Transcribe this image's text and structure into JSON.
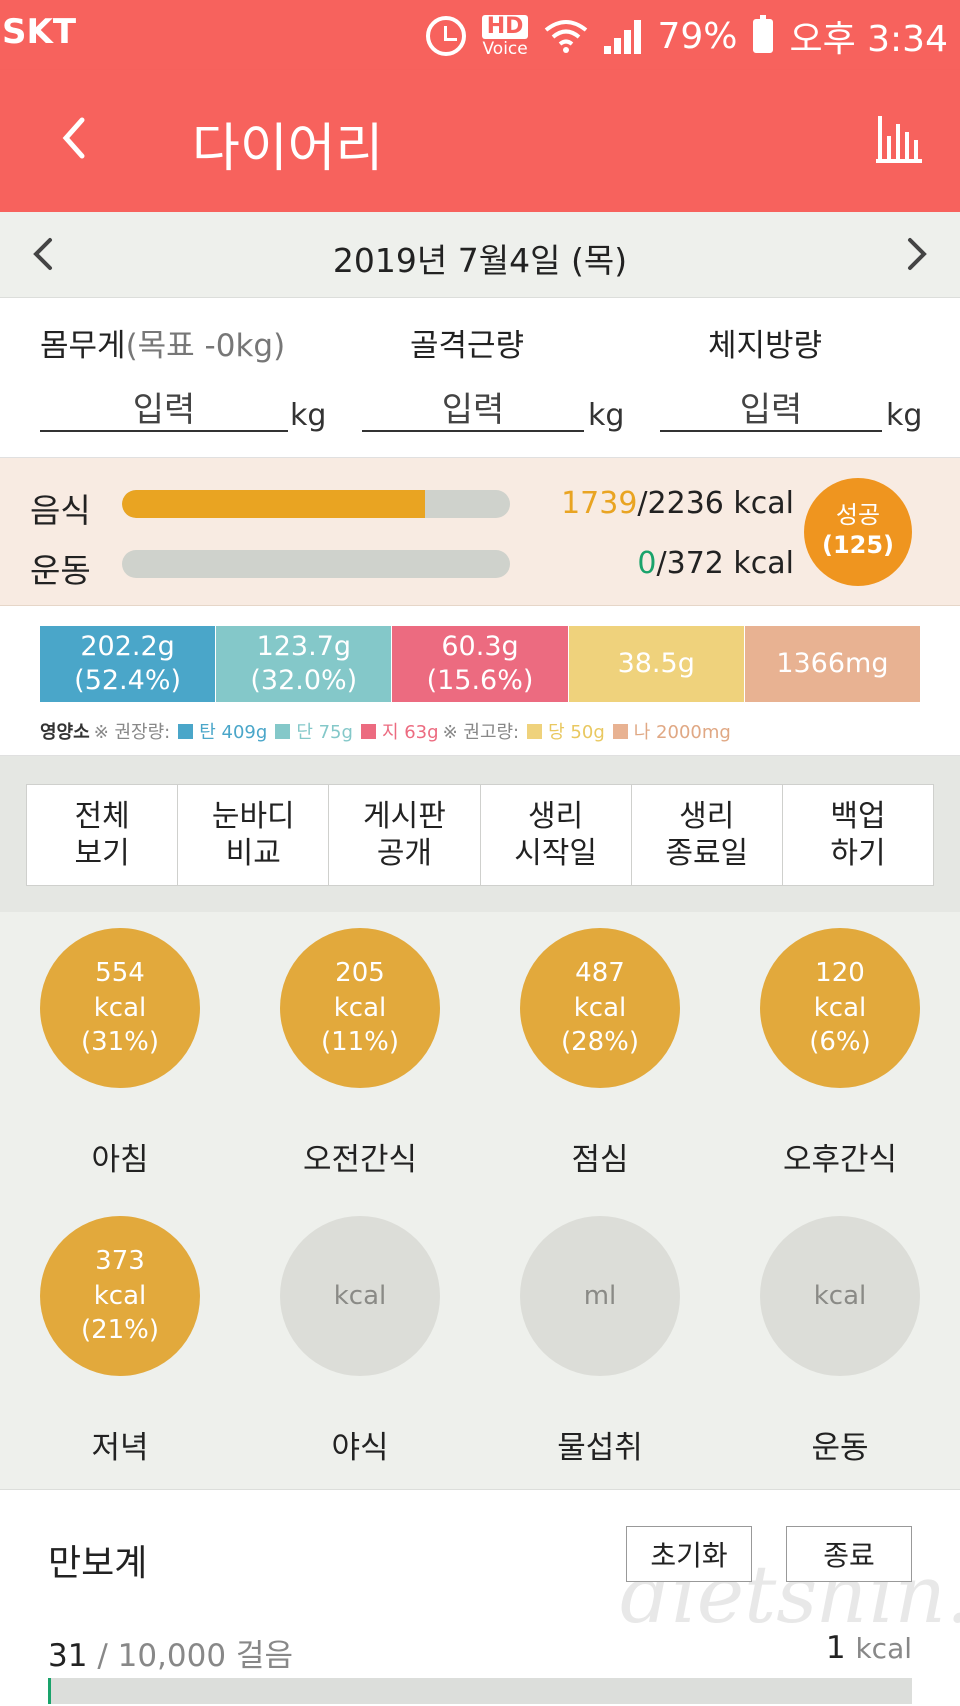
{
  "status_bar": {
    "carrier": "SKT",
    "hd": "HD",
    "voice": "Voice",
    "battery": "79%",
    "time": "오후 3:34"
  },
  "app_bar": {
    "title": "다이어리"
  },
  "date_nav": {
    "date": "2019년 7월4일 (목)"
  },
  "measures": {
    "weight": {
      "label": "몸무게",
      "goal": "(목표 -0kg)",
      "value": "입력",
      "unit": "kg"
    },
    "muscle": {
      "label": "골격근량",
      "value": "입력",
      "unit": "kg"
    },
    "fat": {
      "label": "체지방량",
      "value": "입력",
      "unit": "kg"
    }
  },
  "summary": {
    "food": {
      "label": "음식",
      "current": "1739",
      "target": "/2236 kcal",
      "progress": 0.78
    },
    "exercise": {
      "label": "운동",
      "current": "0",
      "target": "/372 kcal",
      "progress": 0
    },
    "badge": {
      "label": "성공",
      "count": "(125)"
    }
  },
  "nutrients": {
    "segments": [
      {
        "amount": "202.2g",
        "pct": "(52.4%)",
        "color": "#4aa6c9"
      },
      {
        "amount": "123.7g",
        "pct": "(32.0%)",
        "color": "#84c8c9"
      },
      {
        "amount": "60.3g",
        "pct": "(15.6%)",
        "color": "#ec6b80"
      },
      {
        "amount": "38.5g",
        "pct": "",
        "color": "#efd27c"
      },
      {
        "amount": "1366mg",
        "pct": "",
        "color": "#e8b292"
      }
    ],
    "legend": {
      "title": "영양소",
      "rec_label": "※ 권장량:",
      "carb": "탄 409g",
      "protein": "단 75g",
      "fat": "지 63g",
      "limit_label": "※ 권고량:",
      "sugar": "당 50g",
      "sodium": "나 2000mg"
    }
  },
  "actions": [
    {
      "label": "전체\n보기"
    },
    {
      "label": "눈바디\n비교"
    },
    {
      "label": "게시판\n공개"
    },
    {
      "label": "생리\n시작일"
    },
    {
      "label": "생리\n종료일"
    },
    {
      "label": "백업\n하기"
    }
  ],
  "meals": [
    {
      "name": "아침",
      "value": "554",
      "unit": "kcal",
      "pct": "(31%)"
    },
    {
      "name": "오전간식",
      "value": "205",
      "unit": "kcal",
      "pct": "(11%)"
    },
    {
      "name": "점심",
      "value": "487",
      "unit": "kcal",
      "pct": "(28%)"
    },
    {
      "name": "오후간식",
      "value": "120",
      "unit": "kcal",
      "pct": "(6%)"
    },
    {
      "name": "저녁",
      "value": "373",
      "unit": "kcal",
      "pct": "(21%)"
    },
    {
      "name": "야식",
      "value": "",
      "unit": "kcal",
      "pct": ""
    },
    {
      "name": "물섭취",
      "value": "",
      "unit": "ml",
      "pct": ""
    },
    {
      "name": "운동",
      "value": "",
      "unit": "kcal",
      "pct": ""
    }
  ],
  "pedometer": {
    "title": "만보계",
    "reset_label": "초기화",
    "stop_label": "종료",
    "steps": "31",
    "goal": "/ 10,000 걸음",
    "kcal": "1",
    "kcal_unit": "kcal",
    "progress": 0.0031
  },
  "watermark": "dietshin.com",
  "colors": {
    "brand": "#f7625d",
    "meal_active": "#e2a93c",
    "badge": "#ef951f",
    "food_bar": "#e9a422",
    "exercise_text": "#1aa36b"
  }
}
